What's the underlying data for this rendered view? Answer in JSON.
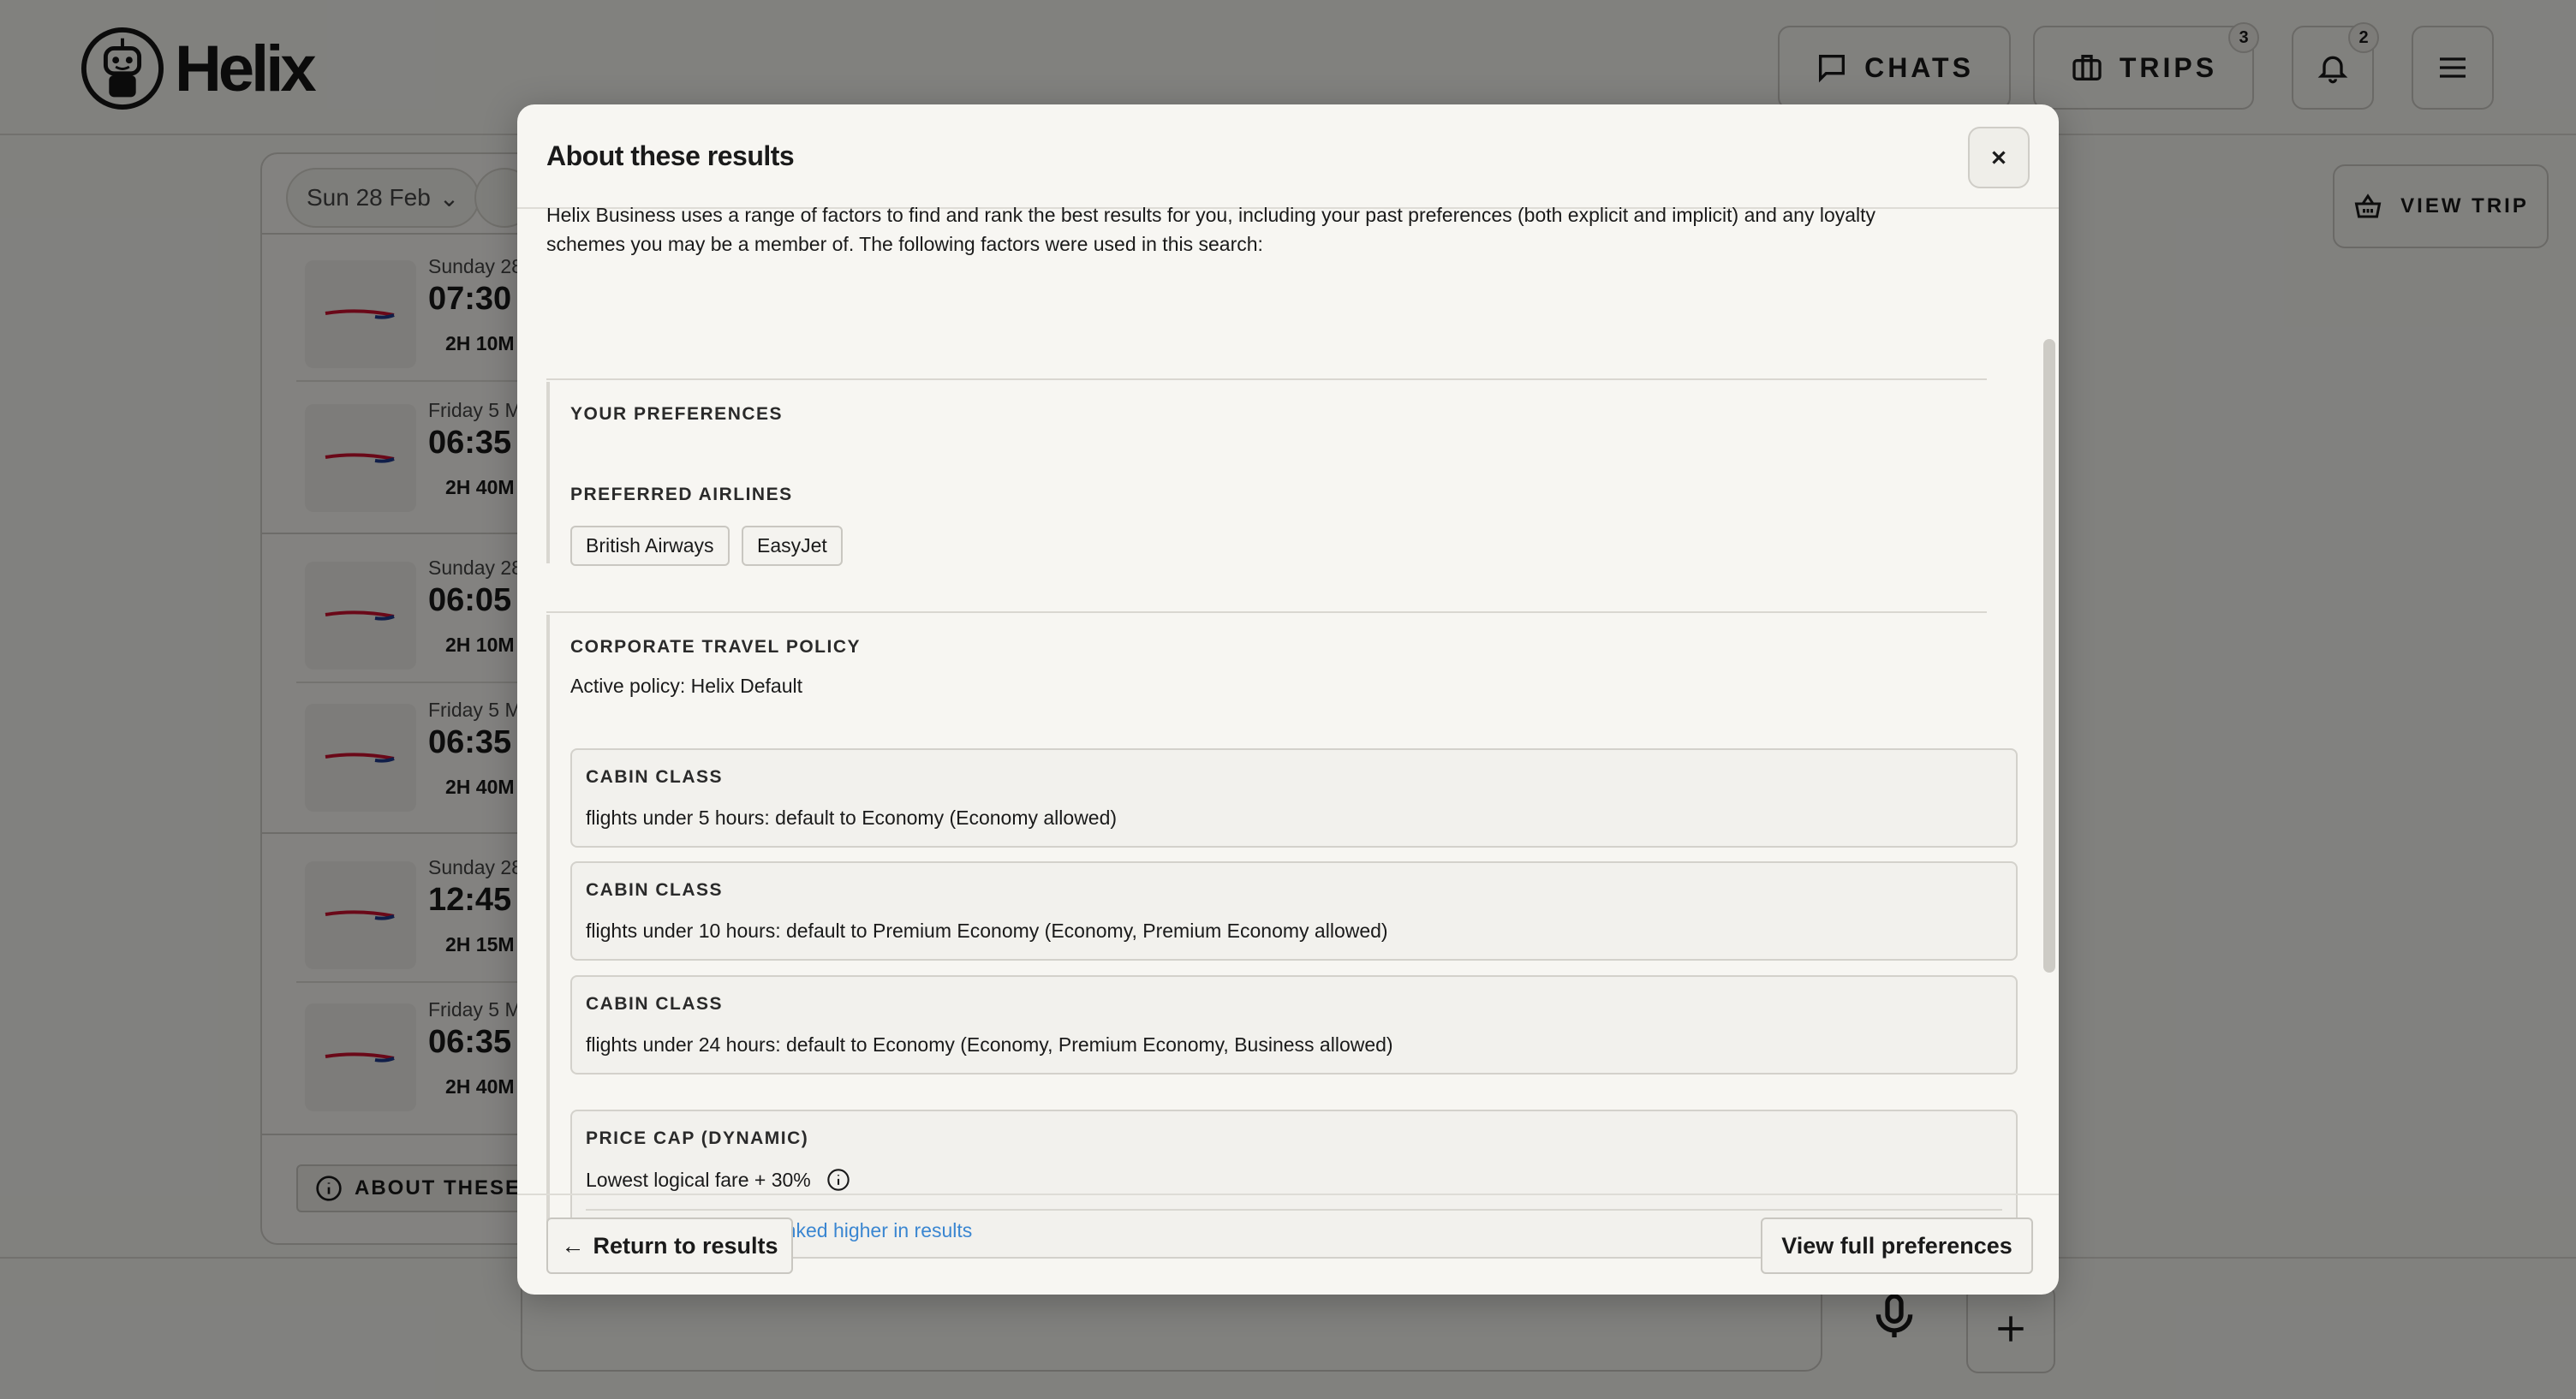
{
  "app": {
    "name": "Helix"
  },
  "header": {
    "chats_label": "CHATS",
    "trips_label": "TRIPS",
    "trips_badge": "3",
    "notifications_badge": "2"
  },
  "results": {
    "date_filter": "Sun 28 Feb",
    "flights": [
      {
        "date": "Sunday 28",
        "time": "07:30",
        "duration": "2H 10M"
      },
      {
        "date": "Friday 5 M",
        "time": "06:35",
        "duration": "2H 40M"
      },
      {
        "date": "Sunday 28",
        "time": "06:05",
        "duration": "2H 10M"
      },
      {
        "date": "Friday 5 M",
        "time": "06:35",
        "duration": "2H 40M"
      },
      {
        "date": "Sunday 28",
        "time": "12:45",
        "duration": "2H 15M"
      },
      {
        "date": "Friday 5 M",
        "time": "06:35",
        "duration": "2H 40M"
      }
    ],
    "about_button": "ABOUT THESE R"
  },
  "view_trip_label": "VIEW TRIP",
  "modal": {
    "title": "About these results",
    "intro_line1": "Helix Business uses a range of factors to find and rank the best results for you, including your past preferences (both explicit and implicit) and any loyalty",
    "intro_line2": "schemes you may be a member of. The following factors were used in this search:",
    "preferences": {
      "heading": "YOUR PREFERENCES",
      "airlines_heading": "PREFERRED AIRLINES",
      "airlines": [
        "British Airways",
        "EasyJet"
      ]
    },
    "policy": {
      "heading": "CORPORATE TRAVEL POLICY",
      "active": "Active policy: Helix Default",
      "rules": [
        {
          "label": "CABIN CLASS",
          "text": "flights under 5 hours: default to Economy (Economy allowed)"
        },
        {
          "label": "CABIN CLASS",
          "text": "flights under 10 hours: default to Premium Economy (Economy, Premium Economy allowed)"
        },
        {
          "label": "CABIN CLASS",
          "text": "flights under 24 hours: default to Economy (Economy, Premium Economy, Business allowed)"
        }
      ],
      "price_cap": {
        "label": "PRICE CAP (DYNAMIC)",
        "text": "Lowest logical fare + 30%",
        "note": "In-policy options are ranked higher in results"
      }
    },
    "return_button": "Return to results",
    "view_prefs_button": "View full preferences"
  },
  "colors": {
    "link": "#3a86d1",
    "accent_red": "#c8102e",
    "accent_blue": "#1f3a8a"
  }
}
